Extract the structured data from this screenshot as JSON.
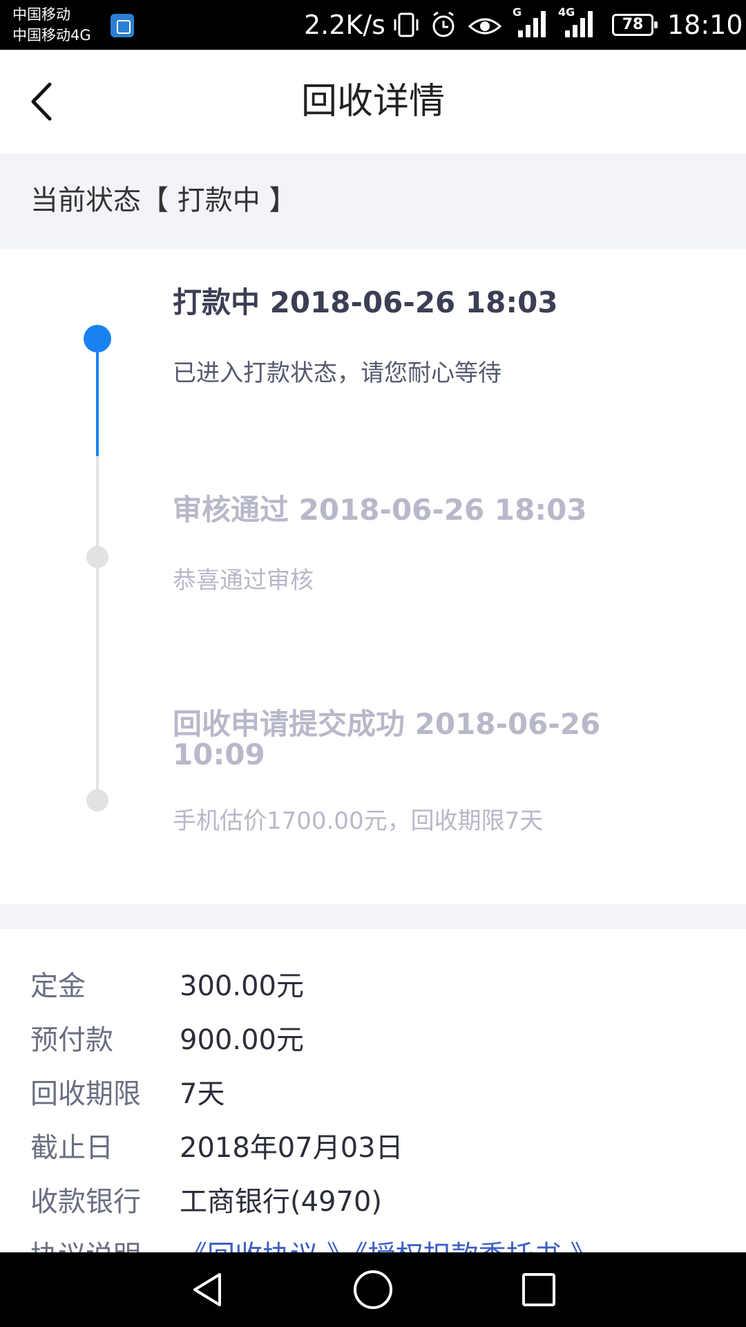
{
  "status_bar": {
    "carrier_1": "中国移动",
    "carrier_2": "中国移动4G",
    "net_speed": "2.2K/s",
    "signal_1_label": "G",
    "signal_2_label": "4G",
    "battery": "78",
    "time": "18:10",
    "icons": [
      "sim-card-icon",
      "vibrate-icon",
      "alarm-icon",
      "eye-icon",
      "signal-icon",
      "battery-icon"
    ]
  },
  "header": {
    "title": "回收详情"
  },
  "status": {
    "text": "当前状态【 打款中 】"
  },
  "timeline": {
    "items": [
      {
        "title": "打款中 2018-06-26 18:03",
        "desc": "已进入打款状态，请您耐心等待"
      },
      {
        "title": "审核通过 2018-06-26 18:03",
        "desc": "恭喜通过审核"
      },
      {
        "title_line1": "回收申请提交成功 2018-06-26",
        "title_line2": "10:09",
        "desc": "手机估价1700.00元，回收期限7天"
      }
    ]
  },
  "details": {
    "rows": [
      {
        "label": "定金",
        "value": "300.00元"
      },
      {
        "label": "预付款",
        "value": "900.00元"
      },
      {
        "label": "回收期限",
        "value": "7天"
      },
      {
        "label": "截止日",
        "value": "2018年07月03日"
      },
      {
        "label": "收款银行",
        "value": "工商银行(4970)"
      },
      {
        "label": "协议说明",
        "link_1": "《回收协议 》",
        "link_2": "《授权扣款委托书 》"
      }
    ]
  },
  "colors": {
    "accent": "#1a82f0",
    "link": "#3d5fc4",
    "inactive": "#b7b8c9",
    "section_bg": "#f2f4f9"
  }
}
